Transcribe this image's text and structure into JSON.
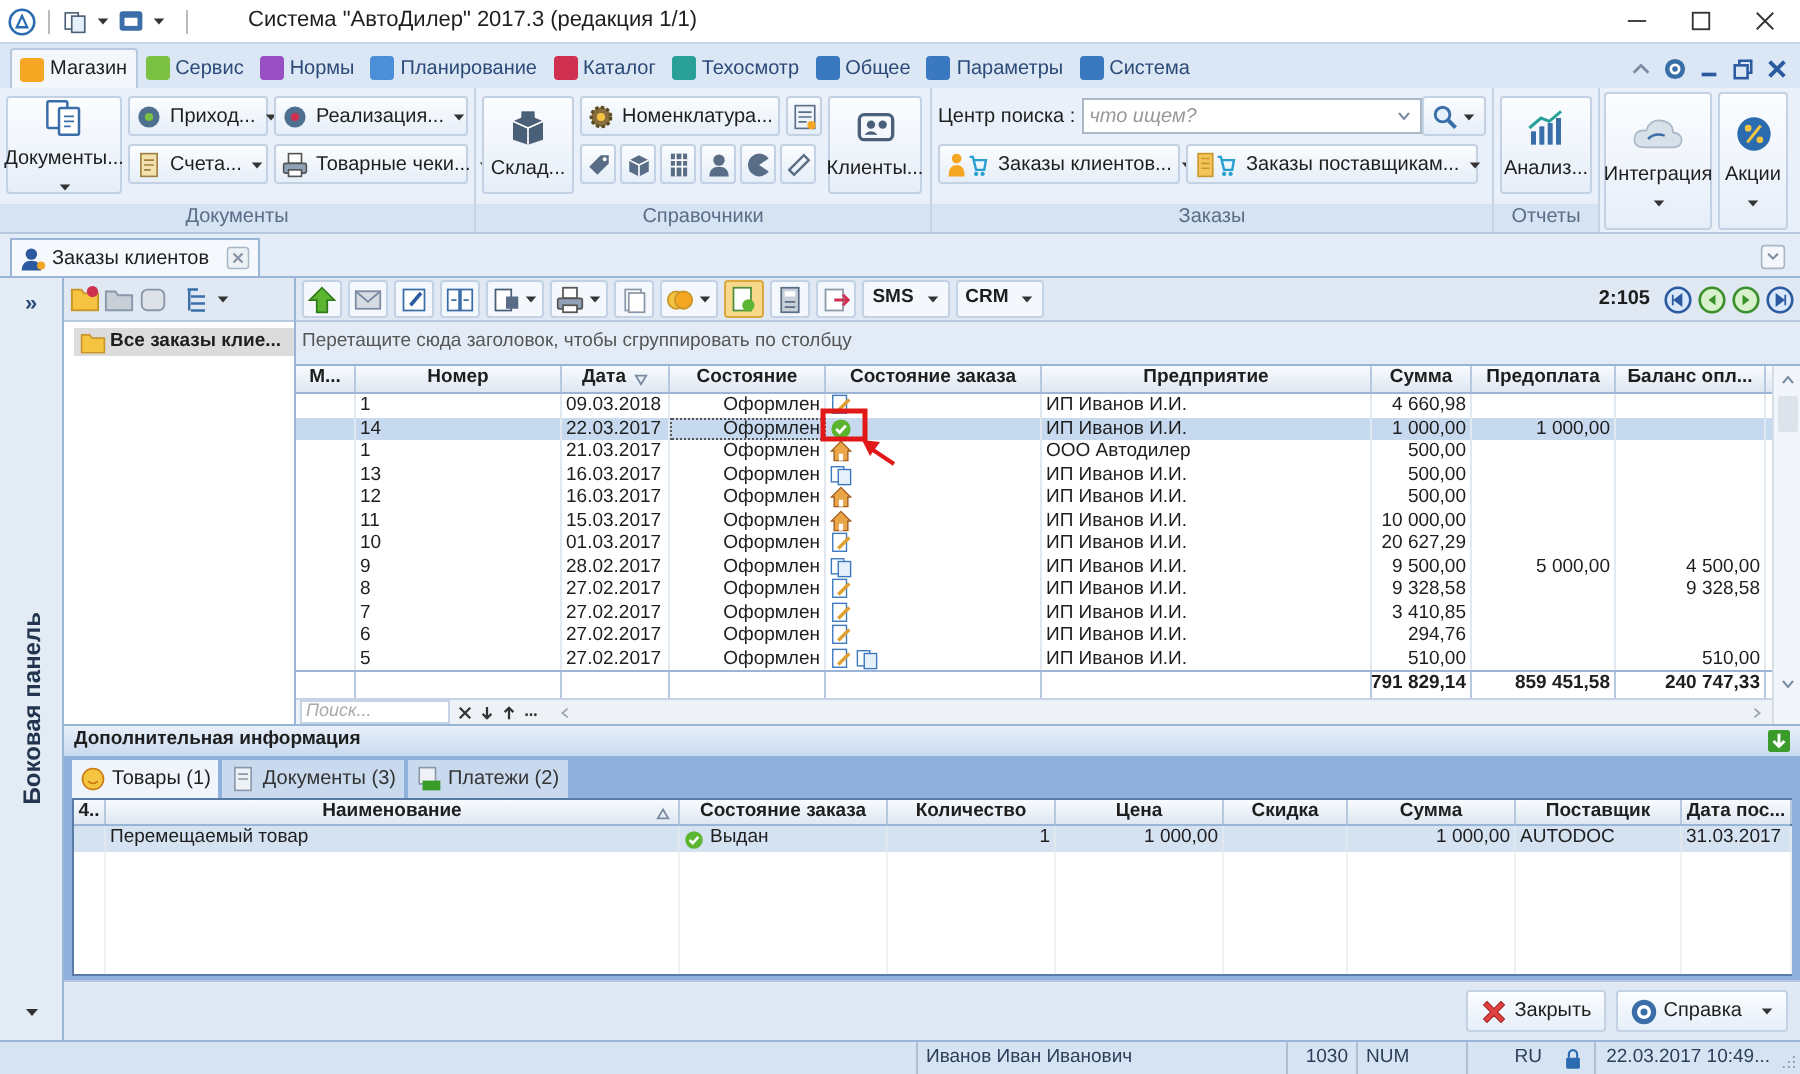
{
  "window": {
    "title": "Система \"АвтоДилер\" 2017.3 (редакция 1/1)"
  },
  "ribbon_tabs": [
    {
      "label": "Магазин",
      "selected": true,
      "color": "#f5a623"
    },
    {
      "label": "Сервис",
      "selected": false,
      "color": "#7cc242"
    },
    {
      "label": "Нормы",
      "selected": false,
      "color": "#9b4fc4"
    },
    {
      "label": "Планирование",
      "selected": false,
      "color": "#4a8fd8"
    },
    {
      "label": "Каталог",
      "selected": false,
      "color": "#d03050"
    },
    {
      "label": "Техосмотр",
      "selected": false,
      "color": "#2aa198"
    },
    {
      "label": "Общее",
      "selected": false,
      "color": "#3a78c0"
    },
    {
      "label": "Параметры",
      "selected": false,
      "color": "#3a78c0"
    },
    {
      "label": "Система",
      "selected": false,
      "color": "#3a78c0"
    }
  ],
  "ribbon": {
    "documents": {
      "title": "Документы",
      "big_button": "Документы...",
      "buttons": [
        "Приход...",
        "Реализация...",
        "Счета...",
        "Товарные чеки..."
      ]
    },
    "references": {
      "title": "Справочники",
      "warehouse": "Склад...",
      "nomenclature": "Номенклатура...",
      "clients": "Клиенты..."
    },
    "orders": {
      "title": "Заказы",
      "search_label": "Центр поиска :",
      "search_placeholder": "что ищем?",
      "buttons": [
        "Заказы клиентов...",
        "Заказы поставщикам..."
      ]
    },
    "reports": {
      "title": "Отчеты",
      "button": "Анализ..."
    },
    "extra_buttons": [
      "Интеграция",
      "Акции"
    ]
  },
  "document_tab": {
    "label": "Заказы клиентов"
  },
  "side_panel": {
    "expand": "»",
    "label": "Боковая панель"
  },
  "tree": [
    {
      "label": "Все заказы клие...",
      "selected": true
    }
  ],
  "grid_toolbar": {
    "buttons": [
      "SMS",
      "CRM"
    ],
    "counter": "2:105"
  },
  "grid": {
    "group_hint": "Перетащите сюда заголовок, чтобы сгруппировать по столбцу",
    "columns": [
      {
        "label": "М...",
        "sorted": false
      },
      {
        "label": "Номер",
        "sorted": false
      },
      {
        "label": "Дата",
        "sorted": true
      },
      {
        "label": "Состояние",
        "sorted": false
      },
      {
        "label": "Состояние заказа",
        "sorted": false
      },
      {
        "label": "Предприятие",
        "sorted": false
      },
      {
        "label": "Сумма",
        "sorted": false
      },
      {
        "label": "Предоплата",
        "sorted": false
      },
      {
        "label": "Баланс опл...",
        "sorted": false
      }
    ],
    "rows": [
      {
        "number": "1",
        "date": "09.03.2018",
        "state": "Оформлен",
        "status_icons": [
          {
            "kind": "edit"
          }
        ],
        "company": "ИП Иванов И.И.",
        "sum": "4 660,98",
        "selected": false
      },
      {
        "number": "14",
        "date": "22.03.2017",
        "state": "Оформлен",
        "status_icons": [
          {
            "kind": "done"
          }
        ],
        "company": "ИП Иванов И.И.",
        "sum": "1 000,00",
        "prepayment": "1 000,00",
        "selected": true
      },
      {
        "number": "1",
        "date": "21.03.2017",
        "state": "Оформлен",
        "status_icons": [
          {
            "kind": "house"
          }
        ],
        "company": "ООО Автодилер",
        "sum": "500,00",
        "selected": false
      },
      {
        "number": "13",
        "date": "16.03.2017",
        "state": "Оформлен",
        "status_icons": [
          {
            "kind": "copy"
          }
        ],
        "company": "ИП Иванов И.И.",
        "sum": "500,00",
        "selected": false
      },
      {
        "number": "12",
        "date": "16.03.2017",
        "state": "Оформлен",
        "status_icons": [
          {
            "kind": "house"
          }
        ],
        "company": "ИП Иванов И.И.",
        "sum": "500,00",
        "selected": false
      },
      {
        "number": "11",
        "date": "15.03.2017",
        "state": "Оформлен",
        "status_icons": [
          {
            "kind": "house"
          }
        ],
        "company": "ИП Иванов И.И.",
        "sum": "10 000,00",
        "selected": false
      },
      {
        "number": "10",
        "date": "01.03.2017",
        "state": "Оформлен",
        "status_icons": [
          {
            "kind": "edit"
          }
        ],
        "company": "ИП Иванов И.И.",
        "sum": "20 627,29",
        "selected": false
      },
      {
        "number": "9",
        "date": "28.02.2017",
        "state": "Оформлен",
        "status_icons": [
          {
            "kind": "copy"
          }
        ],
        "company": "ИП Иванов И.И.",
        "sum": "9 500,00",
        "prepayment": "5 000,00",
        "balance": "4 500,00",
        "selected": false
      },
      {
        "number": "8",
        "date": "27.02.2017",
        "state": "Оформлен",
        "status_icons": [
          {
            "kind": "edit"
          }
        ],
        "company": "ИП Иванов И.И.",
        "sum": "9 328,58",
        "balance": "9 328,58",
        "selected": false
      },
      {
        "number": "7",
        "date": "27.02.2017",
        "state": "Оформлен",
        "status_icons": [
          {
            "kind": "edit"
          }
        ],
        "company": "ИП Иванов И.И.",
        "sum": "3 410,85",
        "selected": false
      },
      {
        "number": "6",
        "date": "27.02.2017",
        "state": "Оформлен",
        "status_icons": [
          {
            "kind": "edit"
          }
        ],
        "company": "ИП Иванов И.И.",
        "sum": "294,76",
        "selected": false
      },
      {
        "number": "5",
        "date": "27.02.2017",
        "state": "Оформлен",
        "status_icons": [
          {
            "kind": "edit"
          },
          {
            "kind": "copy"
          }
        ],
        "company": "ИП Иванов И.И.",
        "sum": "510,00",
        "balance": "510,00",
        "selected": false
      }
    ],
    "totals": {
      "sum": "791 829,14",
      "prepayment": "859 451,58",
      "balance": "240 747,33"
    },
    "search_placeholder": "Поиск..."
  },
  "details": {
    "title": "Дополнительная информация",
    "tabs": [
      {
        "label": "Товары (1)",
        "selected": true
      },
      {
        "label": "Документы (3)",
        "selected": false
      },
      {
        "label": "Платежи (2)",
        "selected": false
      }
    ],
    "columns": [
      {
        "label": "4..",
        "sorted": false
      },
      {
        "label": "Наименование",
        "sorted": true
      },
      {
        "label": "Состояние заказа",
        "sorted": false
      },
      {
        "label": "Количество",
        "sorted": false
      },
      {
        "label": "Цена",
        "sorted": false
      },
      {
        "label": "Скидка",
        "sorted": false
      },
      {
        "label": "Сумма",
        "sorted": false
      },
      {
        "label": "Поставщик",
        "sorted": false
      },
      {
        "label": "Дата пос...",
        "sorted": false
      }
    ],
    "rows": [
      {
        "name": "Перемещаемый товар",
        "status": "Выдан",
        "status_icon": {
          "kind": "done"
        },
        "quantity": "1",
        "price": "1 000,00",
        "sum": "1 000,00",
        "supplier": "AUTODOC",
        "date": "31.03.2017",
        "selected": true
      }
    ]
  },
  "buttons": [
    {
      "label": "Закрыть",
      "kind": "close"
    },
    {
      "label": "Справка",
      "kind": "help"
    }
  ],
  "status_bar": {
    "user": "Иванов Иван Иванович",
    "code": "1030",
    "num": "NUM",
    "lang": "RU",
    "datetime": "22.03.2017 10:49..."
  }
}
